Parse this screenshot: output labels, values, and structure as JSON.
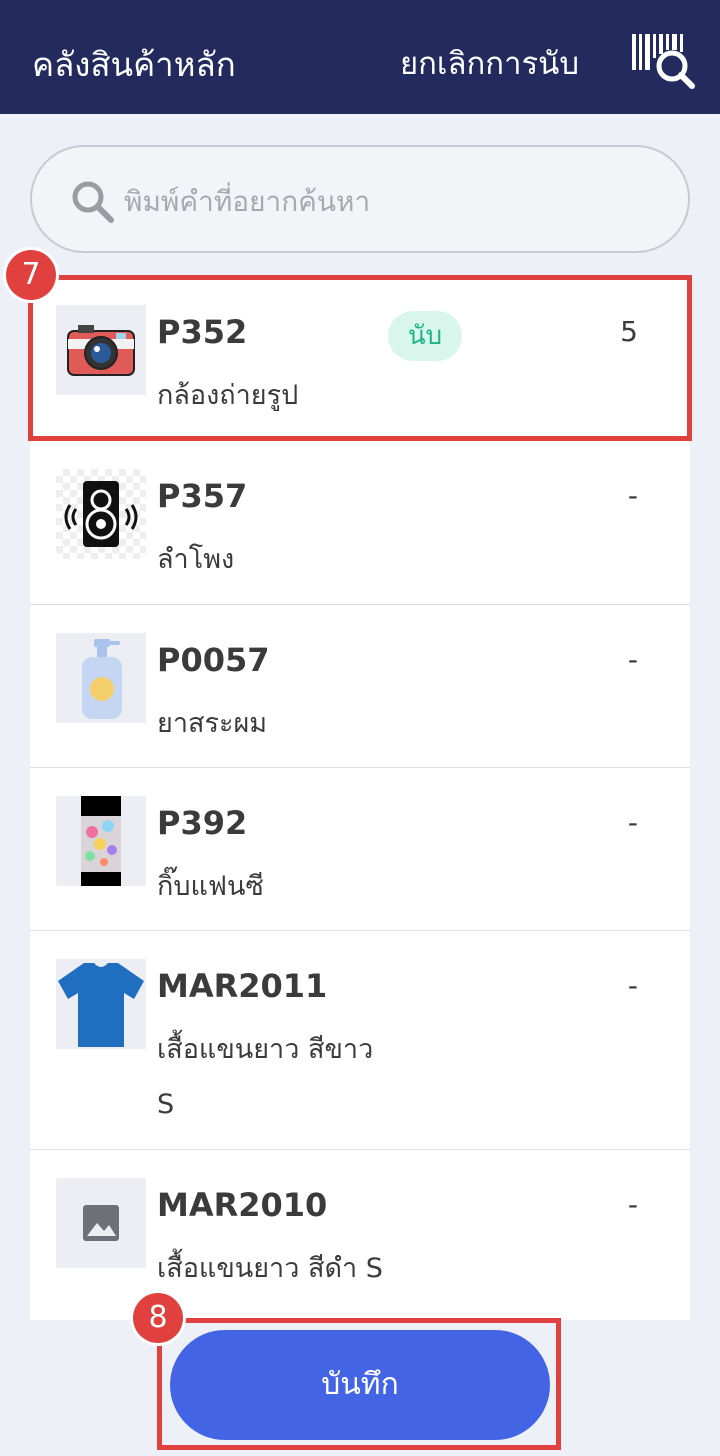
{
  "header": {
    "title": "คลังสินค้าหลัก",
    "cancel_label": "ยกเลิกการนับ",
    "scan_icon": "barcode-search-icon"
  },
  "search": {
    "placeholder": "พิมพ์คำที่อยากค้นหา",
    "icon": "search-icon"
  },
  "items": [
    {
      "code": "P352",
      "name": "กล้องถ่ายรูป",
      "badge": "นับ",
      "qty": "5",
      "image": "camera-icon"
    },
    {
      "code": "P357",
      "name": "ลำโพง",
      "qty": "-",
      "image": "speaker-icon"
    },
    {
      "code": "P0057",
      "name": "ยาสระผม",
      "qty": "-",
      "image": "shampoo-bottle-icon"
    },
    {
      "code": "P392",
      "name": "กิ๊บแฟนซี",
      "qty": "-",
      "image": "hair-clips-photo"
    },
    {
      "code": "MAR2011",
      "name": "เสื้อแขนยาว สีขาว S",
      "qty": "-",
      "image": "tshirt-icon"
    },
    {
      "code": "MAR2010",
      "name": "เสื้อแขนยาว สีดำ S",
      "qty": "-",
      "image": "image-placeholder-icon"
    }
  ],
  "annotations": {
    "step7": "7",
    "step8": "8"
  },
  "save_label": "บันทึก",
  "colors": {
    "header": "#232a5e",
    "accent": "#4464e6",
    "highlight": "#e0413f",
    "badge_bg": "#d8f6ec",
    "badge_text": "#20b386"
  }
}
